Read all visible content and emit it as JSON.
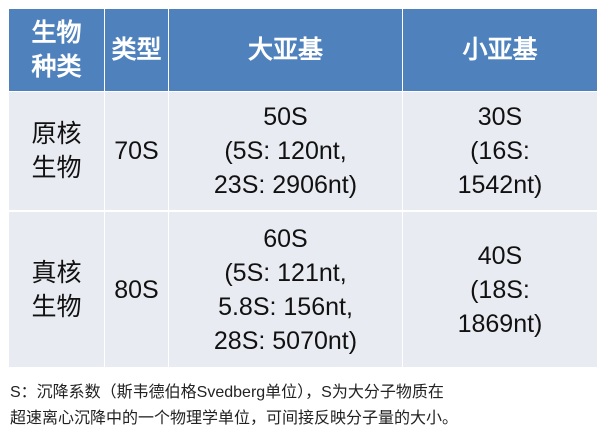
{
  "table": {
    "headers": [
      "生物种类",
      "类型",
      "大亚基",
      "小亚基"
    ],
    "rows": [
      {
        "organism": "原核生物",
        "type": "70S",
        "large": [
          "50S",
          "(5S: 120nt,",
          "23S: 2906nt)"
        ],
        "small": [
          "30S",
          "(16S:",
          "1542nt)"
        ]
      },
      {
        "organism": "真核生物",
        "type": "80S",
        "large": [
          "60S",
          "(5S: 121nt,",
          "5.8S: 156nt,",
          "28S: 5070nt)"
        ],
        "small": [
          "40S",
          "(18S:",
          "1869nt)"
        ]
      }
    ],
    "header_color": "#4f81bd",
    "row_color": "#e9ebf2"
  },
  "footnote": {
    "line1": "S：沉降系数（斯韦德伯格Svedberg单位），S为大分子物质在",
    "line2": "超速离心沉降中的一个物理学单位，可间接反映分子量的大小。"
  }
}
